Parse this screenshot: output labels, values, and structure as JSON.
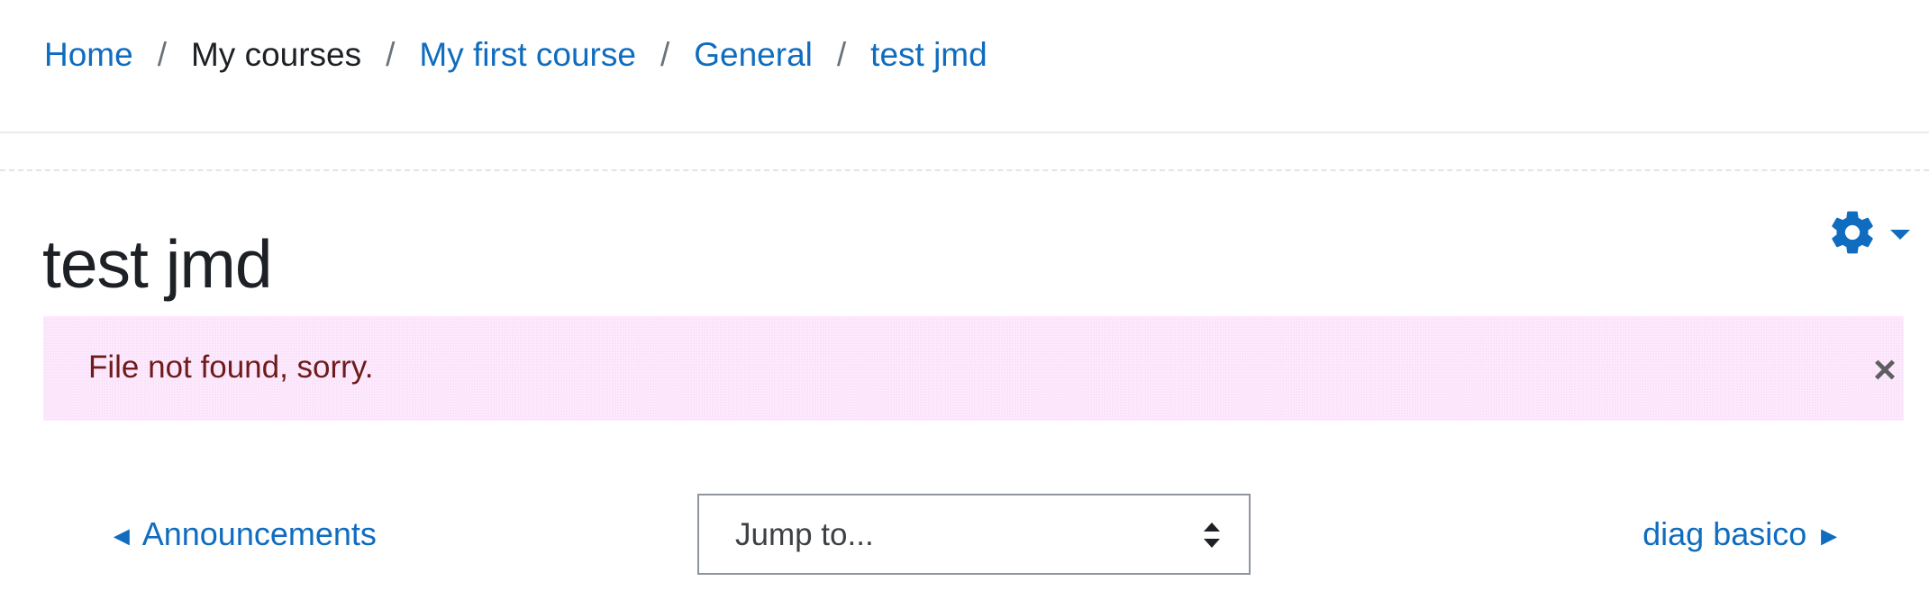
{
  "breadcrumb": {
    "home": "Home",
    "sep1": "/",
    "my_courses": "My courses",
    "sep2": "/",
    "course": "My first course",
    "sep3": "/",
    "section": "General",
    "sep4": "/",
    "activity": "test jmd"
  },
  "page": {
    "title": "test jmd"
  },
  "settings": {
    "icon": "gear-icon",
    "caret_icon": "caret-down-icon"
  },
  "alert": {
    "message": "File not found, sorry.",
    "close_label": "×"
  },
  "activity_nav": {
    "prev_arrow": "◄",
    "prev_label": "Announcements",
    "jump_placeholder": "Jump to...",
    "next_label": "diag basico",
    "next_arrow": "►"
  },
  "colors": {
    "link": "#0f6cbf",
    "alert_bg": "#fbe2fb",
    "alert_text": "#6e1b1b"
  }
}
